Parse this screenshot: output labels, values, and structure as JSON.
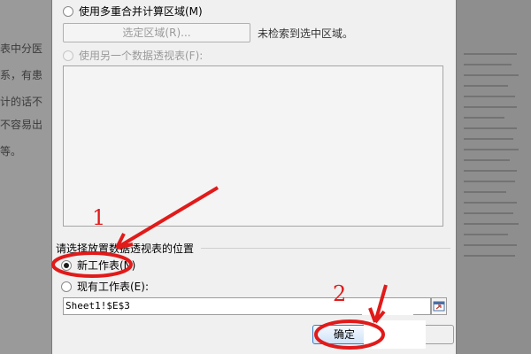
{
  "background": {
    "left_fragments": [
      "表中分医",
      "系，有患",
      "计的话不",
      "不容易出",
      "等。"
    ]
  },
  "dialog": {
    "multi_range": {
      "label": "使用多重合并计算区域(M)",
      "checked": false
    },
    "select_range_button": "选定区域(R)...",
    "select_range_note": "未检索到选中区域。",
    "other_pivot": {
      "label": "使用另一个数据透视表(F):",
      "checked": false,
      "disabled": true
    },
    "location_section_title": "请选择放置数据透视表的位置",
    "new_worksheet": {
      "label": "新工作表(N)",
      "checked": true
    },
    "existing_worksheet": {
      "label": "现有工作表(E):",
      "checked": false
    },
    "location_value": "Sheet1!$E$3",
    "ok_button": "确定"
  },
  "annotations": {
    "step1": "1",
    "step2": "2",
    "color": "#e11a1a"
  },
  "colors": {
    "dialog_bg": "#f0f0f0",
    "ok_border": "#3a79c7"
  }
}
